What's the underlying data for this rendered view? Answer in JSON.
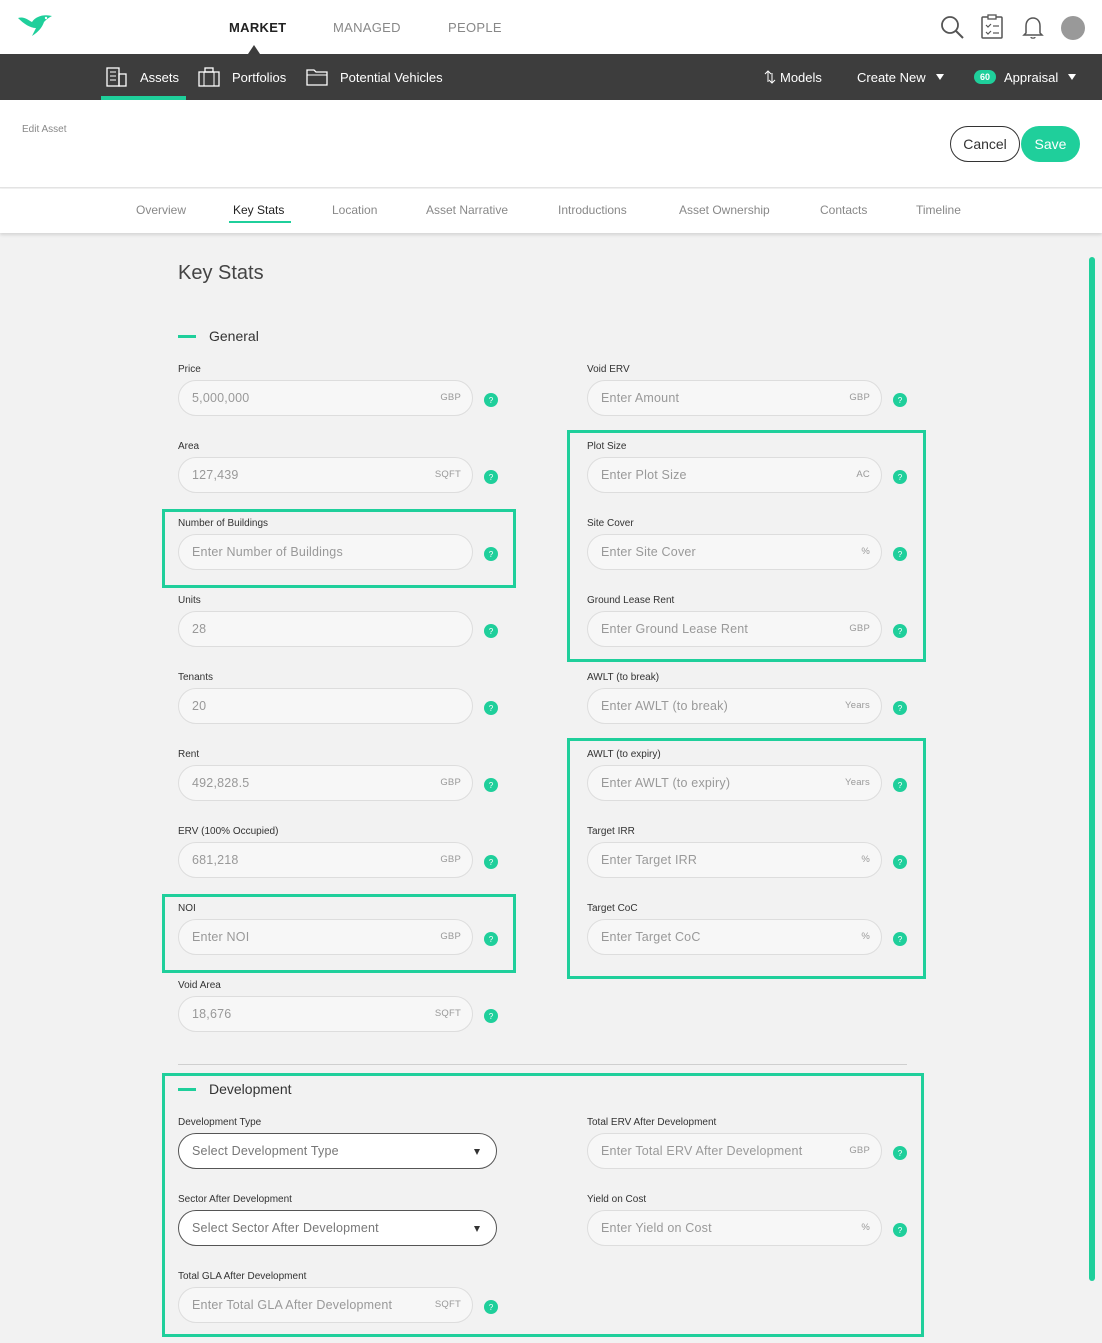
{
  "top_nav": {
    "items": [
      {
        "label": "MARKET",
        "active": true
      },
      {
        "label": "MANAGED",
        "active": false
      },
      {
        "label": "PEOPLE",
        "active": false
      }
    ]
  },
  "sub_nav": {
    "items": [
      {
        "label": "Assets",
        "icon": "building-icon",
        "active": true
      },
      {
        "label": "Portfolios",
        "icon": "briefcase-icon",
        "active": false
      },
      {
        "label": "Potential Vehicles",
        "icon": "folder-icon",
        "active": false
      }
    ],
    "models_label": "Models",
    "create_new_label": "Create New",
    "appraisal_badge": "60",
    "appraisal_label": "Appraisal"
  },
  "header": {
    "edit_label": "Edit Asset",
    "cancel_label": "Cancel",
    "save_label": "Save"
  },
  "tabs": [
    {
      "label": "Overview",
      "active": false
    },
    {
      "label": "Key Stats",
      "active": true
    },
    {
      "label": "Location",
      "active": false
    },
    {
      "label": "Asset Narrative",
      "active": false
    },
    {
      "label": "Introductions",
      "active": false
    },
    {
      "label": "Asset Ownership",
      "active": false
    },
    {
      "label": "Contacts",
      "active": false
    },
    {
      "label": "Timeline",
      "active": false
    }
  ],
  "page_title": "Key Stats",
  "general": {
    "title": "General",
    "left": [
      {
        "label": "Price",
        "value": "5,000,000",
        "unit": "GBP"
      },
      {
        "label": "Area",
        "value": "127,439",
        "unit": "SQFT"
      },
      {
        "label": "Number of Buildings",
        "value": "Enter Number of Buildings",
        "unit": ""
      },
      {
        "label": "Units",
        "value": "28",
        "unit": ""
      },
      {
        "label": "Tenants",
        "value": "20",
        "unit": ""
      },
      {
        "label": "Rent",
        "value": "492,828.5",
        "unit": "GBP"
      },
      {
        "label": "ERV (100% Occupied)",
        "value": "681,218",
        "unit": "GBP"
      },
      {
        "label": "NOI",
        "value": "Enter NOI",
        "unit": "GBP"
      },
      {
        "label": "Void Area",
        "value": "18,676",
        "unit": "SQFT"
      }
    ],
    "right": [
      {
        "label": "Void ERV",
        "value": "Enter Amount",
        "unit": "GBP"
      },
      {
        "label": "Plot Size",
        "value": "Enter Plot Size",
        "unit": "AC"
      },
      {
        "label": "Site Cover",
        "value": "Enter Site Cover",
        "unit": "%"
      },
      {
        "label": "Ground Lease Rent",
        "value": "Enter Ground Lease Rent",
        "unit": "GBP"
      },
      {
        "label": "AWLT (to break)",
        "value": "Enter AWLT (to break)",
        "unit": "Years"
      },
      {
        "label": "AWLT (to expiry)",
        "value": "Enter AWLT (to expiry)",
        "unit": "Years"
      },
      {
        "label": "Target IRR",
        "value": "Enter Target IRR",
        "unit": "%"
      },
      {
        "label": "Target CoC",
        "value": "Enter Target CoC",
        "unit": "%"
      }
    ]
  },
  "development": {
    "title": "Development",
    "left": [
      {
        "label": "Development Type",
        "value": "Select Development Type",
        "unit": ""
      },
      {
        "label": "Sector After Development",
        "value": "Select Sector After Development",
        "unit": ""
      },
      {
        "label": "Total GLA After Development",
        "value": "Enter Total GLA After Development",
        "unit": "SQFT"
      }
    ],
    "right": [
      {
        "label": "Total ERV After Development",
        "value": "Enter Total ERV After Development",
        "unit": "GBP"
      },
      {
        "label": "Yield on Cost",
        "value": "Enter Yield on Cost",
        "unit": "%"
      }
    ]
  },
  "help_glyph": "?",
  "colors": {
    "accent": "#1fcf9b",
    "subnav_bg": "#3d3d3d",
    "page_bg": "#f2f2f2"
  }
}
